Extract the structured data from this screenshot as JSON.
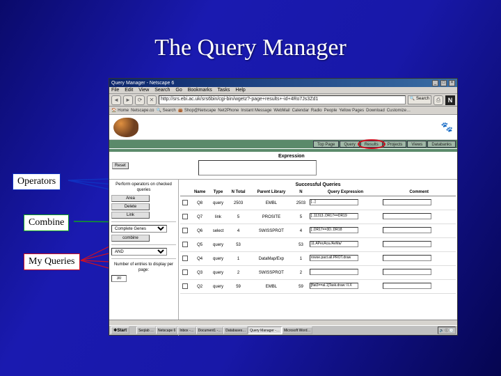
{
  "slide": {
    "title": "The Query Manager"
  },
  "window": {
    "title": "Query Manager - Netscape 6"
  },
  "menu": [
    "File",
    "Edit",
    "View",
    "Search",
    "Go",
    "Bookmarks",
    "Tasks",
    "Help"
  ],
  "toolbar": {
    "url": "http://srs.ebi.ac.uk/srs6bin/cgi-bin/wgetz?-page+results+-id+4Ro7Js3Zd1",
    "search": "Search",
    "print": "Print"
  },
  "bookmarks": [
    "Home",
    "Netscape.co",
    "Search",
    "Shop@Netscape",
    "Net2Phone",
    "Instant Message",
    "WebMail",
    "Calendar",
    "Radio",
    "People",
    "Yellow Pages",
    "Download",
    "Customize…"
  ],
  "app": {
    "tabs": [
      "Top Page",
      "Query",
      "Results",
      "Projects",
      "Views",
      "Databanks"
    ],
    "circled_tab_index": 2,
    "reset": "Reset",
    "expression_label": "Expression",
    "left": {
      "section1_title": "Perform operators on\nchecked queries",
      "ops": [
        "Area",
        "Delete",
        "Link"
      ],
      "section2_label": "Complete Genes",
      "combine": "combine",
      "section3_title": "Number of entries to\ndisplay per page:",
      "num_per_page": "30"
    },
    "table": {
      "title": "Successful Queries",
      "headers": [
        "",
        "Name",
        "Type",
        "N Total",
        "Parent Library",
        "N",
        "Query Expression",
        "Comment"
      ],
      "rows": [
        {
          "name": "Q8",
          "type": "query",
          "ntotal": "2503",
          "lib": "EMBL",
          "n": "2503",
          "expr": "[...]"
        },
        {
          "name": "Q7",
          "type": "link",
          "ntotal": "5",
          "lib": "PROSITE",
          "n": "5",
          "expr": "[..11313..DR17==DR19"
        },
        {
          "name": "Q6",
          "type": "select",
          "ntotal": "4",
          "lib": "SWISSPROT",
          "n": "4",
          "expr": "[..DR17==3D..DR18"
        },
        {
          "name": "Q5",
          "type": "query",
          "ntotal": "53",
          "lib": "",
          "n": "53",
          "expr": "11.APecAca./AvMa/"
        },
        {
          "name": "Q4",
          "type": "query",
          "ntotal": "1",
          "lib": "DataMap/Exp",
          "n": "1",
          "expr": "rowse.pact.all.PROT.draw"
        },
        {
          "name": "Q3",
          "type": "query",
          "ntotal": "2",
          "lib": "SWISSPROT",
          "n": "2",
          "expr": " "
        },
        {
          "name": "Q2",
          "type": "query",
          "ntotal": "59",
          "lib": "EMBL",
          "n": "59",
          "expr": "[flat3==al.1]Task.draw:\nII.X"
        }
      ]
    }
  },
  "taskbar": {
    "start": "Start",
    "tasks": [
      "Seqlab …",
      "Netscape 6",
      "Inbox -…",
      "Document1 -…",
      "Databases…",
      "Query Manager -…",
      "Microsoft Word…"
    ],
    "active_index": 5
  },
  "callouts": {
    "operators": "Operators",
    "combine": "Combine",
    "myqueries": "My Queries"
  }
}
